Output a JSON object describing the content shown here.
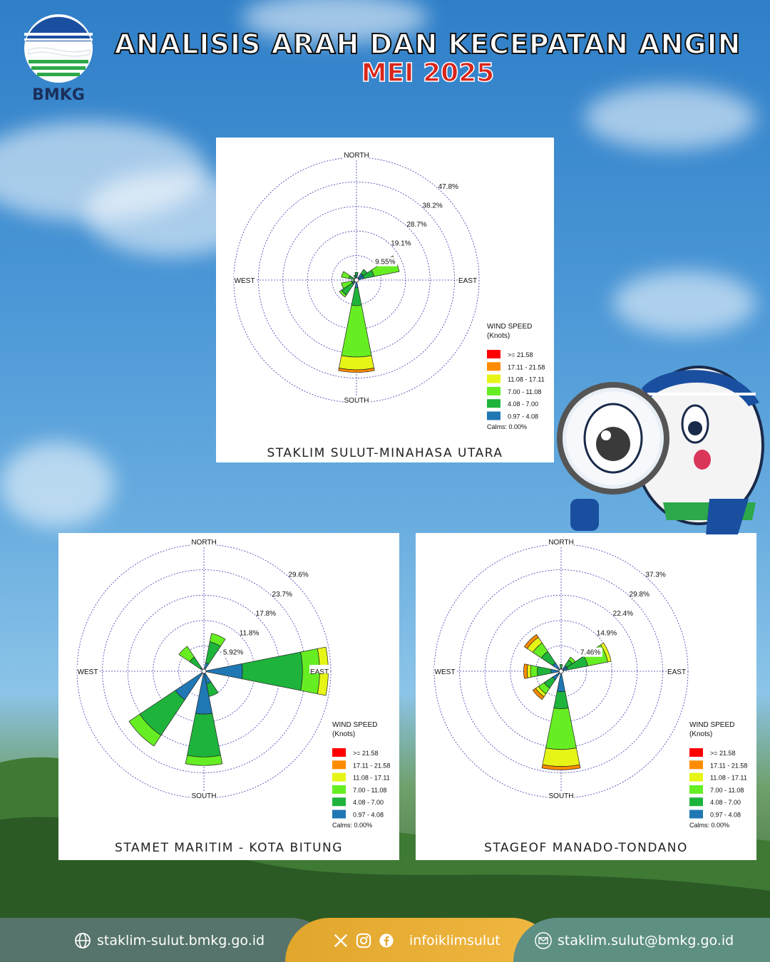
{
  "header": {
    "logo_text": "BMKG",
    "title": "ANALISIS ARAH DAN KECEPATAN ANGIN",
    "subtitle": "MEI 2025"
  },
  "legend": {
    "title_line1": "WIND SPEED",
    "title_line2": "(Knots)",
    "bins": [
      {
        "label": ">= 21.58",
        "color": "#ff0000"
      },
      {
        "label": "17.11 - 21.58",
        "color": "#ff8c00"
      },
      {
        "label": "11.08 - 17.11",
        "color": "#e6f516"
      },
      {
        "label": "7.00 - 11.08",
        "color": "#66ee22"
      },
      {
        "label": "4.08 - 7.00",
        "color": "#1eb43c"
      },
      {
        "label": "0.97 - 4.08",
        "color": "#1f78b4"
      }
    ],
    "calms": "Calms: 0.00%"
  },
  "compass": {
    "north": "NORTH",
    "south": "SOUTH",
    "east": "EAST",
    "west": "WEST"
  },
  "chart_data": [
    {
      "type": "windrose",
      "station": "STAKLIM SULUT-MINAHASA UTARA",
      "ring_labels": [
        "9.55%",
        "19.1%",
        "28.7%",
        "38.2%",
        "47.8%"
      ],
      "rmax": 47.8,
      "directions": [
        {
          "dir": 0,
          "bins": [
            2,
            1,
            0,
            0,
            0,
            0
          ]
        },
        {
          "dir": 45,
          "bins": [
            3,
            2,
            0,
            0,
            0,
            0
          ]
        },
        {
          "dir": 67.5,
          "bins": [
            3,
            4,
            10,
            0,
            0,
            0
          ]
        },
        {
          "dir": 180,
          "bins": [
            3,
            7,
            20,
            5,
            1,
            0
          ]
        },
        {
          "dir": 225,
          "bins": [
            2,
            5,
            1,
            0,
            0,
            0
          ]
        },
        {
          "dir": 247.5,
          "bins": [
            0,
            2,
            4,
            0,
            0,
            0
          ]
        },
        {
          "dir": 292.5,
          "bins": [
            1,
            2,
            3,
            0,
            0,
            0
          ]
        },
        {
          "dir": 337.5,
          "bins": [
            1,
            1,
            0,
            0,
            0,
            0
          ]
        }
      ]
    },
    {
      "type": "windrose",
      "station": "STAMET MARITIM - KOTA BITUNG",
      "ring_labels": [
        "5.92%",
        "11.8%",
        "17.8%",
        "23.7%",
        "29.6%"
      ],
      "rmax": 29.6,
      "directions": [
        {
          "dir": 22.5,
          "bins": [
            2,
            5,
            2,
            0,
            0,
            0
          ]
        },
        {
          "dir": 90,
          "bins": [
            9,
            14,
            4,
            2,
            0,
            0
          ]
        },
        {
          "dir": 157.5,
          "bins": [
            3,
            3,
            0,
            0,
            0,
            0
          ]
        },
        {
          "dir": 180,
          "bins": [
            10,
            10,
            2,
            0,
            0,
            0
          ]
        },
        {
          "dir": 225,
          "bins": [
            8,
            10,
            3,
            0,
            0,
            0
          ]
        },
        {
          "dir": 315,
          "bins": [
            1,
            3,
            3,
            0,
            0,
            0
          ]
        }
      ]
    },
    {
      "type": "windrose",
      "station": "STAGEOF MANADO-TONDANO",
      "ring_labels": [
        "7.46%",
        "14.9%",
        "22.4%",
        "29.8%",
        "37.3%"
      ],
      "rmax": 37.3,
      "directions": [
        {
          "dir": 0,
          "bins": [
            1,
            1,
            0,
            0,
            0,
            0
          ]
        },
        {
          "dir": 45,
          "bins": [
            2,
            2,
            1,
            0,
            0,
            0
          ]
        },
        {
          "dir": 67.5,
          "bins": [
            2,
            6,
            6,
            1,
            0,
            0
          ]
        },
        {
          "dir": 180,
          "bins": [
            6,
            5,
            12,
            5,
            1,
            0
          ]
        },
        {
          "dir": 225,
          "bins": [
            3,
            3,
            2,
            1,
            1,
            0
          ]
        },
        {
          "dir": 270,
          "bins": [
            3,
            4,
            2,
            1,
            1,
            0
          ]
        },
        {
          "dir": 315,
          "bins": [
            3,
            4,
            3,
            2,
            1,
            0
          ]
        }
      ]
    }
  ],
  "footer": {
    "website": "staklim-sulut.bmkg.go.id",
    "social": "infoiklimsulut",
    "email": "staklim.sulut@bmkg.go.id"
  }
}
